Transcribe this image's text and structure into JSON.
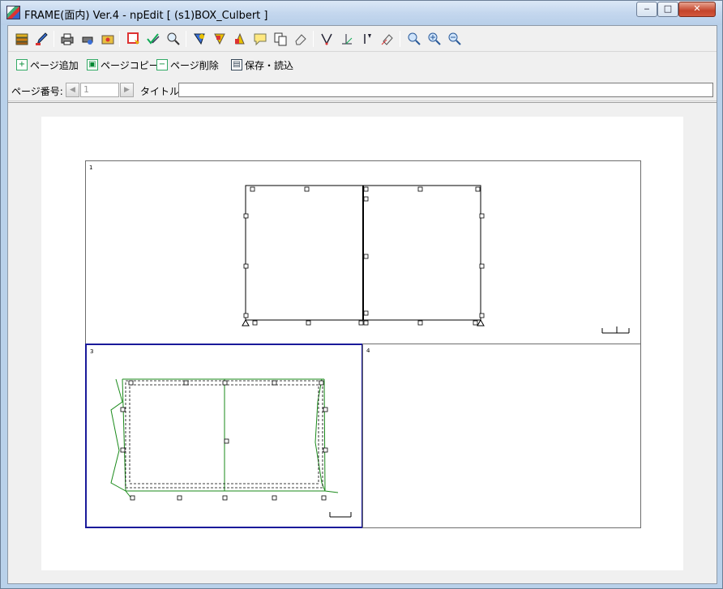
{
  "window": {
    "title": "FRAME(面内) Ver.4 - npEdit [ (s1)BOX_Culbert ]",
    "controls": {
      "minimize": "‒",
      "maximize": "□",
      "close": "✕"
    }
  },
  "toolbar": {
    "icons": [
      "stack-icon",
      "pen-icon",
      "printer-icon",
      "print-setup-icon",
      "folder-icon",
      "frame-icon",
      "check-icon",
      "zoom-region-icon",
      "shape-a-icon",
      "shape-b-icon",
      "shape-c-icon",
      "comment-icon",
      "copy-icon",
      "eraser-icon",
      "member-icon",
      "node-icon",
      "load-icon",
      "delete-icon",
      "zoom-in-icon",
      "zoom-plus-icon",
      "zoom-fit-icon"
    ]
  },
  "pagebar": {
    "add": "ページ追加",
    "copy": "ページコピー",
    "delete": "ページ削除",
    "save": "保存・読込"
  },
  "fields": {
    "page_label": "ページ番号:",
    "page_value": "1",
    "title_label": "タイトル:",
    "title_value": ""
  },
  "panels": {
    "p1": "1",
    "p3": "3",
    "p4": "4"
  },
  "colors": {
    "frame_black": "#000000",
    "diagram_green": "#1a8a1a",
    "selected_panel": "#0000a0"
  }
}
